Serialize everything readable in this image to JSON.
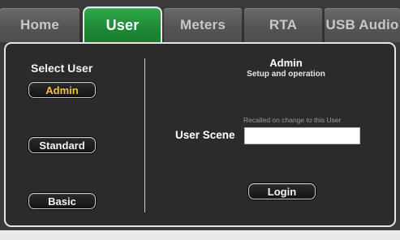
{
  "tabs": [
    {
      "label": "Home",
      "active": false
    },
    {
      "label": "User",
      "active": true
    },
    {
      "label": "Meters",
      "active": false
    },
    {
      "label": "RTA",
      "active": false
    },
    {
      "label": "USB Audio",
      "active": false
    }
  ],
  "select_user": {
    "title": "Select User",
    "users": [
      {
        "label": "Admin",
        "selected": true
      },
      {
        "label": "Standard",
        "selected": false
      },
      {
        "label": "Basic",
        "selected": false
      }
    ]
  },
  "details": {
    "name": "Admin",
    "description": "Setup and operation",
    "hint": "Recalled on change to this User",
    "scene_label": "User Scene",
    "scene_value": "",
    "login_label": "Login"
  },
  "colors": {
    "active_tab": "#1f8a36",
    "selected_user_text": "#f0c23a",
    "panel_bg": "#2b2b2b"
  }
}
